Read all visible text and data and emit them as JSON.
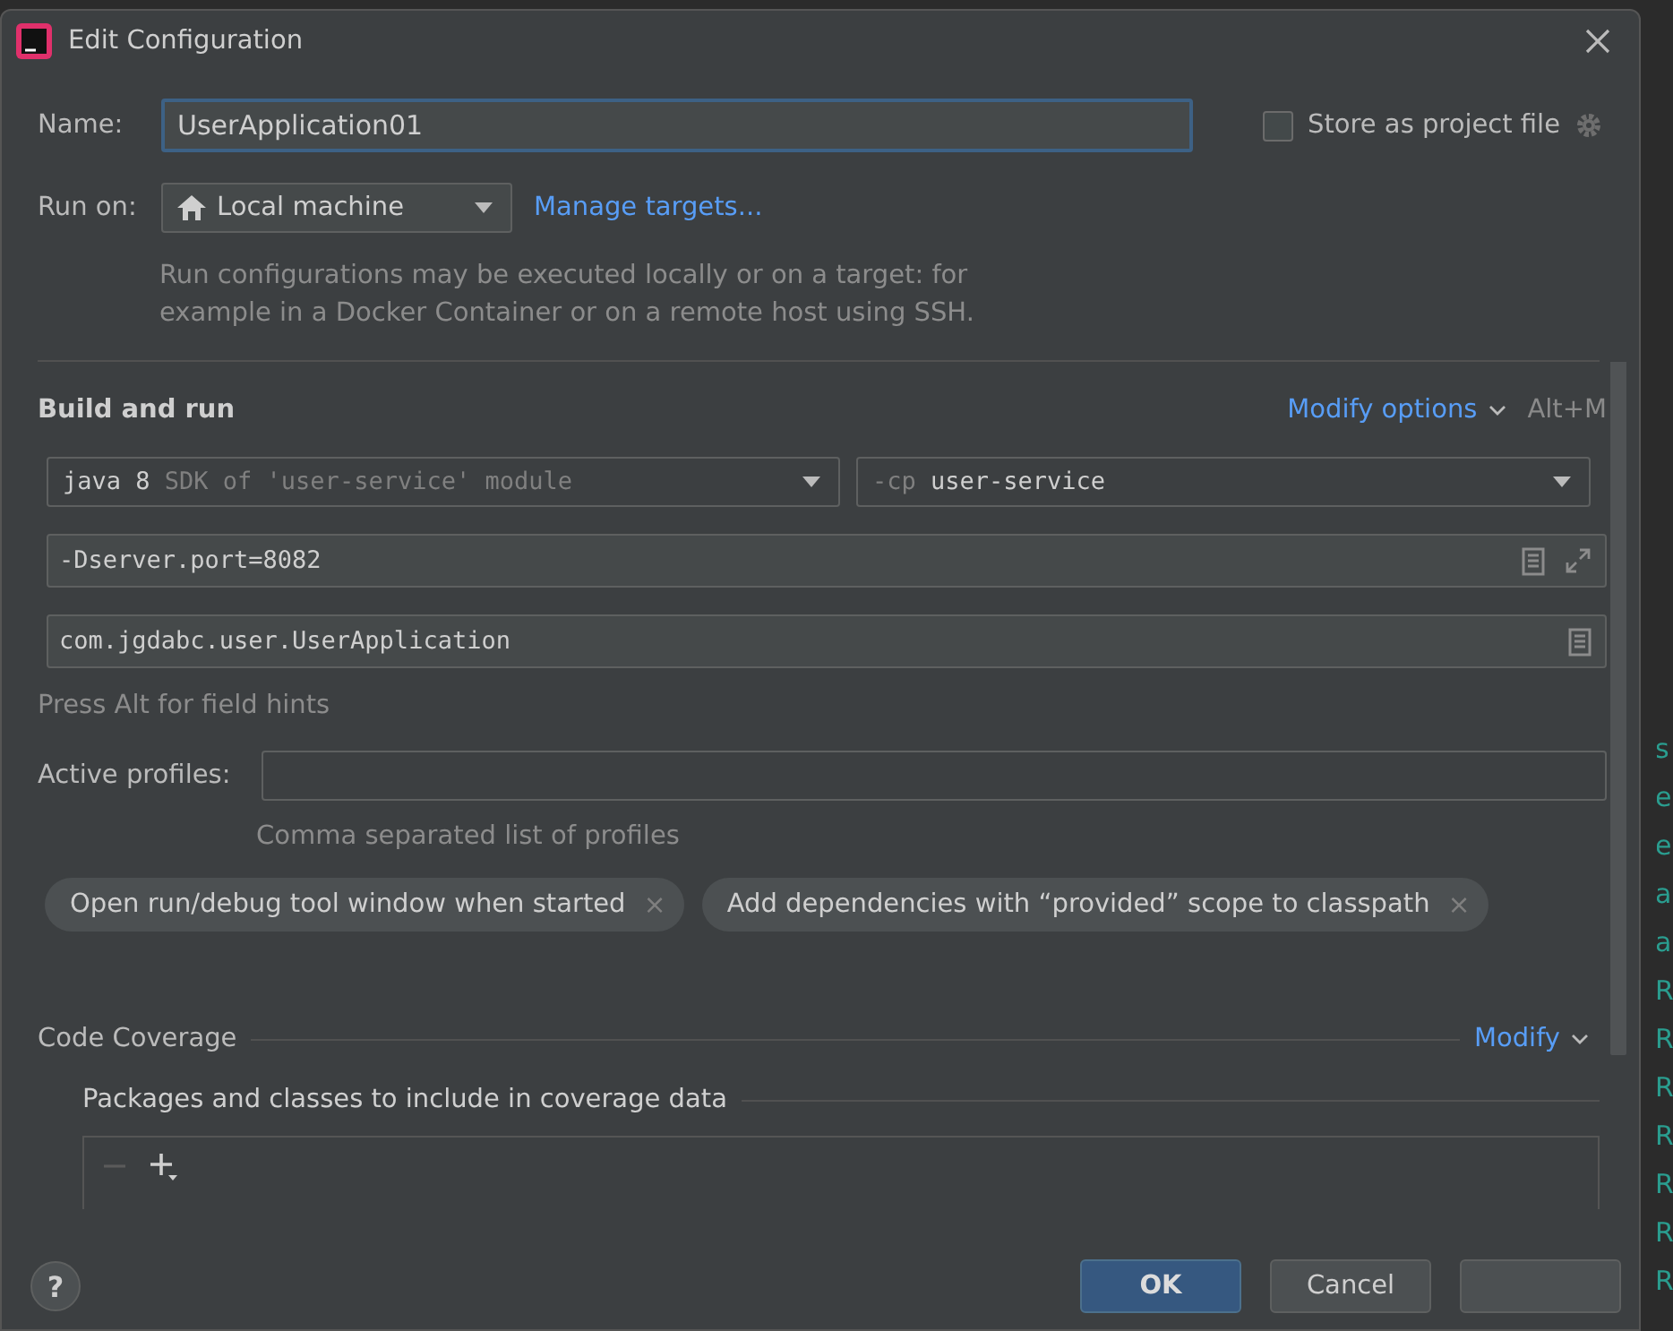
{
  "window": {
    "title": "Edit Configuration"
  },
  "name": {
    "label": "Name:",
    "value": "UserApplication01"
  },
  "store_as_project_file": {
    "label": "Store as project file",
    "checked": false
  },
  "run_on": {
    "label": "Run on:",
    "value": "Local machine",
    "link": "Manage targets..."
  },
  "run_on_hint": [
    "Run configurations may be executed locally or on a target: for",
    "example in a Docker Container or on a remote host using SSH."
  ],
  "build_and_run": {
    "title": "Build and run",
    "modify_link": "Modify options",
    "shortcut": "Alt+M",
    "jre": {
      "value": "java 8",
      "hint": "SDK of 'user-service' module"
    },
    "classpath": {
      "prefix": "-cp",
      "value": "user-service"
    },
    "vm_options": "-Dserver.port=8082",
    "main_class": "com.jgdabc.user.UserApplication",
    "field_hint": "Press Alt for field hints"
  },
  "active_profiles": {
    "label": "Active profiles:",
    "hint": "Comma separated list of profiles"
  },
  "options": [
    {
      "label": "Open run/debug tool window when started",
      "close": "×"
    },
    {
      "label": "Add dependencies with “provided” scope to classpath",
      "close": "×"
    }
  ],
  "code_coverage": {
    "title": "Code Coverage",
    "modify_link": "Modify",
    "packages_title": "Packages and classes to include in coverage data"
  },
  "help": "?",
  "buttons": [
    {
      "label": "OK",
      "default": true
    },
    {
      "label": "Cancel",
      "default": false
    },
    {
      "default": false
    }
  ],
  "editor_fragments": [
    "s",
    "e",
    "e",
    "a",
    "a",
    "R",
    "R",
    "R",
    "R",
    "R",
    "R",
    "R"
  ]
}
